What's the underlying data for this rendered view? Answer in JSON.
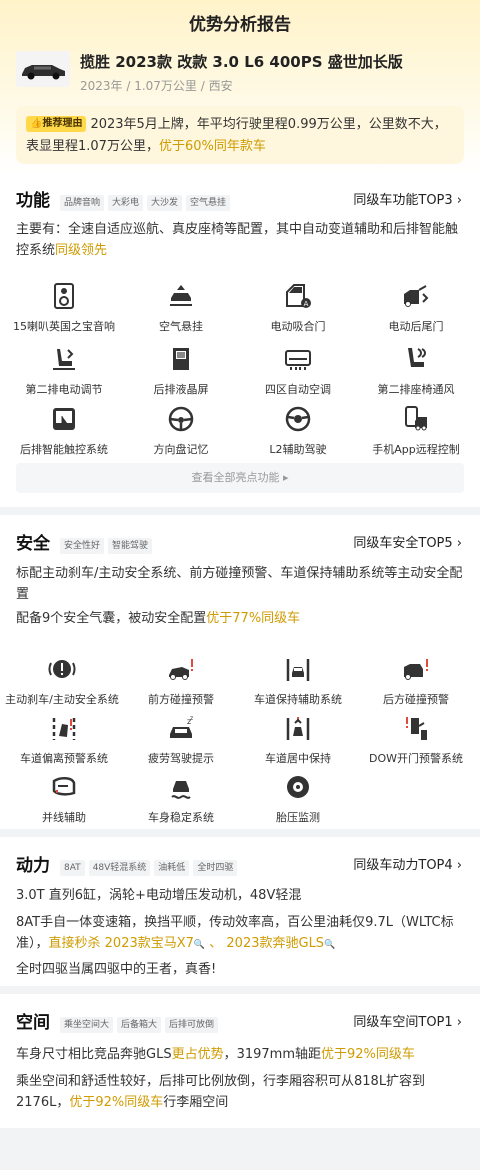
{
  "page_title": "优势分析报告",
  "car": {
    "name": "揽胜 2023款 改款 3.0 L6 400PS 盛世加长版",
    "meta": "2023年 / 1.07万公里 / 西安"
  },
  "reason": {
    "tag": "推荐理由",
    "text": "2023年5月上牌，年平均行驶里程0.99万公里，公里数不大，表显里程1.07万公里，",
    "highlight": "优于60%同年款车"
  },
  "function": {
    "title": "功能",
    "chips": [
      "品牌音响",
      "大彩电",
      "大沙发",
      "空气悬挂"
    ],
    "rank": "同级车功能TOP3 ›",
    "summary": "主要有：全速自适应巡航、真皮座椅等配置，其中自动变道辅助和后排智能触控系统",
    "summary_highlight": "同级领先",
    "features": [
      {
        "label": "15喇叭英国之宝音响",
        "icon": "speaker-icon"
      },
      {
        "label": "空气悬挂",
        "icon": "air-suspension-icon"
      },
      {
        "label": "电动吸合门",
        "icon": "soft-close-door-icon"
      },
      {
        "label": "电动后尾门",
        "icon": "power-tailgate-icon"
      },
      {
        "label": "第二排电动调节",
        "icon": "power-seat-icon"
      },
      {
        "label": "后排液晶屏",
        "icon": "rear-screen-icon"
      },
      {
        "label": "四区自动空调",
        "icon": "climate-control-icon"
      },
      {
        "label": "第二排座椅通风",
        "icon": "seat-ventilation-icon"
      },
      {
        "label": "后排智能触控系统",
        "icon": "touch-control-icon"
      },
      {
        "label": "方向盘记忆",
        "icon": "steering-memory-icon"
      },
      {
        "label": "L2辅助驾驶",
        "icon": "driver-assist-icon"
      },
      {
        "label": "手机App远程控制",
        "icon": "phone-app-icon"
      }
    ],
    "see_all": "查看全部亮点功能 ▸"
  },
  "safety": {
    "title": "安全",
    "chips": [
      "安全性好",
      "智能驾驶"
    ],
    "rank": "同级车安全TOP5 ›",
    "line1": "标配主动刹车/主动安全系统、前方碰撞预警、车道保持辅助系统等主动安全配置",
    "line2": "配备9个安全气囊，被动安全配置",
    "line2_highlight": "优于77%同级车",
    "features": [
      {
        "label": "主动刹车/主动安全系统",
        "icon": "active-brake-icon"
      },
      {
        "label": "前方碰撞预警",
        "icon": "forward-collision-icon"
      },
      {
        "label": "车道保持辅助系统",
        "icon": "lane-keep-icon"
      },
      {
        "label": "后方碰撞预警",
        "icon": "rear-collision-icon"
      },
      {
        "label": "车道偏离预警系统",
        "icon": "lane-departure-icon"
      },
      {
        "label": "疲劳驾驶提示",
        "icon": "fatigue-alert-icon"
      },
      {
        "label": "车道居中保持",
        "icon": "lane-center-icon"
      },
      {
        "label": "DOW开门预警系统",
        "icon": "door-open-warning-icon"
      },
      {
        "label": "并线辅助",
        "icon": "blind-spot-icon"
      },
      {
        "label": "车身稳定系统",
        "icon": "stability-control-icon"
      },
      {
        "label": "胎压监测",
        "icon": "tire-pressure-icon"
      }
    ]
  },
  "power": {
    "title": "动力",
    "chips": [
      "8AT",
      "48V轻混系统",
      "油耗低",
      "全时四驱"
    ],
    "rank": "同级车动力TOP4 ›",
    "line1": "3.0T 直列6缸，涡轮+电动增压发动机，48V轻混",
    "line2": "8AT手自一体变速箱，换挡平顺，传动效率高，百公里油耗仅9.7L（WLTC标准），",
    "line2_highlight": "直接秒杀 2023款宝马X7",
    "line2_sep": " 、 ",
    "line2_highlight2": "2023款奔驰GLS",
    "line3": "全时四驱当属四驱中的王者，真香!"
  },
  "space": {
    "title": "空间",
    "chips": [
      "乘坐空间大",
      "后备箱大",
      "后排可放倒"
    ],
    "rank": "同级车空间TOP1 ›",
    "line1": "车身尺寸相比竞品奔驰GLS",
    "line1_h1": "更占优势",
    "line1_mid": "，3197mm轴距",
    "line1_h2": "优于92%同级车",
    "line2": "乘坐空间和舒适性较好，后排可比例放倒，行李厢容积可从818L扩容到2176L，",
    "line2_highlight": "优于92%同级车",
    "line2_tail": "行李厢空间"
  },
  "colors": {
    "accent": "#cf9b00",
    "tag_bg": "#ffd94a",
    "warn": "#f5a623"
  }
}
